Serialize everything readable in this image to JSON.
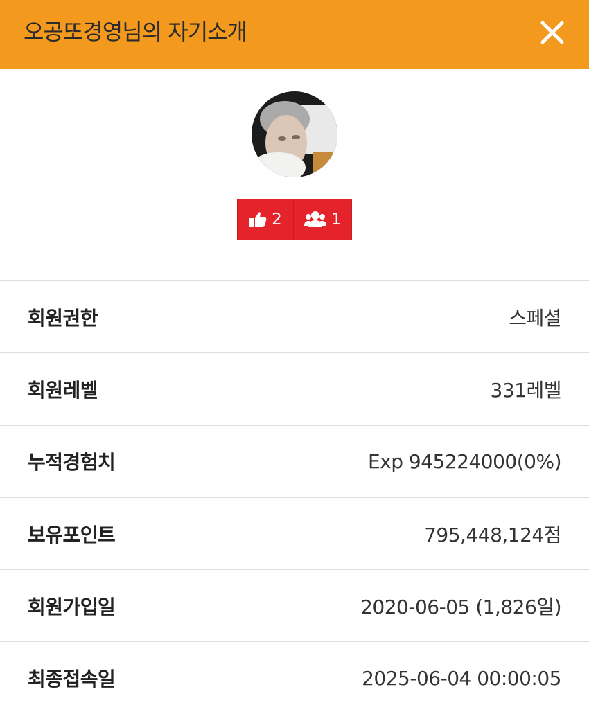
{
  "header": {
    "title": "오공또경영님의 자기소개",
    "close_icon": "close-icon",
    "background_color": "#f39a1e"
  },
  "profile": {
    "avatar": "avatar",
    "likes": {
      "icon": "thumbs-up-icon",
      "count": "2"
    },
    "friends": {
      "icon": "users-icon",
      "count": "1"
    },
    "badge_color": "#e5232b"
  },
  "info_rows": [
    {
      "label": "회원권한",
      "value": "스페셜"
    },
    {
      "label": "회원레벨",
      "value": "331레벨"
    },
    {
      "label": "누적경험치",
      "value": "Exp 945224000(0%)"
    },
    {
      "label": "보유포인트",
      "value": "795,448,124점"
    },
    {
      "label": "회원가입일",
      "value": "2020-06-05 (1,826일)"
    },
    {
      "label": "최종접속일",
      "value": "2025-06-04 00:00:05"
    }
  ]
}
